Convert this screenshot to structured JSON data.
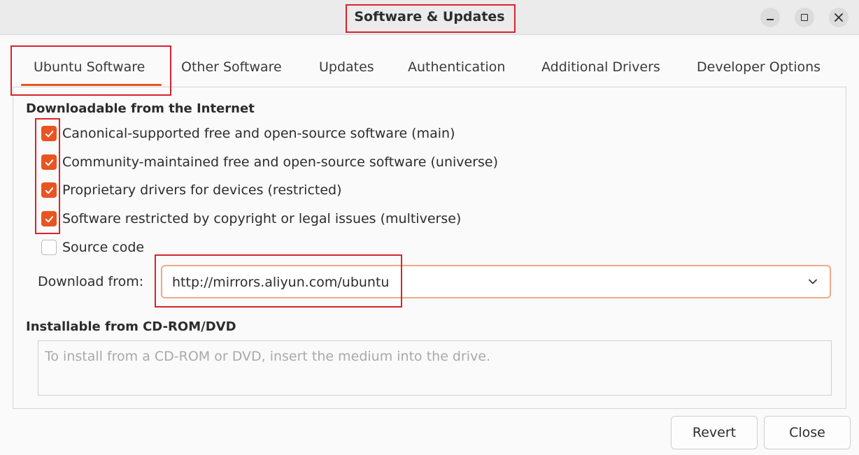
{
  "window": {
    "title": "Software & Updates"
  },
  "tabs": [
    {
      "label": "Ubuntu Software",
      "active": true
    },
    {
      "label": "Other Software"
    },
    {
      "label": "Updates"
    },
    {
      "label": "Authentication"
    },
    {
      "label": "Additional Drivers"
    },
    {
      "label": "Developer Options"
    }
  ],
  "downloadable": {
    "heading": "Downloadable from the Internet",
    "options": [
      {
        "label": "Canonical-supported free and open-source software (main)",
        "checked": true
      },
      {
        "label": "Community-maintained free and open-source software (universe)",
        "checked": true
      },
      {
        "label": "Proprietary drivers for devices (restricted)",
        "checked": true
      },
      {
        "label": "Software restricted by copyright or legal issues (multiverse)",
        "checked": true
      },
      {
        "label": "Source code",
        "checked": false
      }
    ],
    "download_from_label": "Download from:",
    "download_from_value": "http://mirrors.aliyun.com/ubuntu"
  },
  "cdrom": {
    "heading": "Installable from CD-ROM/DVD",
    "placeholder": "To install from a CD-ROM or DVD, insert the medium into the drive."
  },
  "buttons": {
    "revert": "Revert",
    "close": "Close"
  },
  "colors": {
    "accent": "#e95420",
    "annotation": "#d9232d"
  },
  "icons": [
    "minimize-icon",
    "maximize-icon",
    "close-icon",
    "checkmark-icon",
    "chevron-down-icon"
  ]
}
